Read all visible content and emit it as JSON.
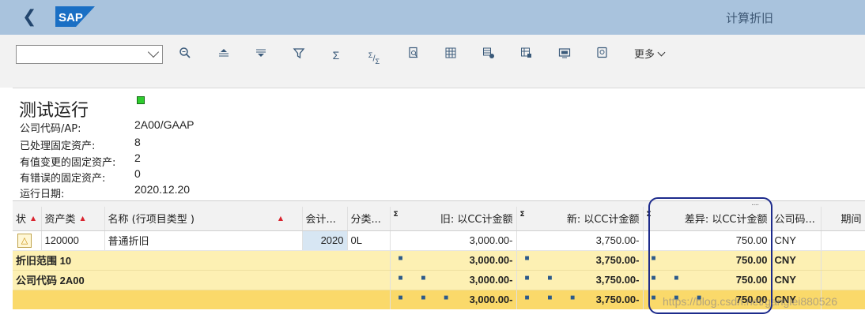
{
  "shell": {
    "app_title": "计算折旧",
    "logo_text": "SAP",
    "back_icon": "chevron-left-icon"
  },
  "toolbar": {
    "variant_value": "",
    "icons": [
      "zoom-in-icon",
      "align-top-icon",
      "align-center-icon",
      "filter-icon",
      "sum-icon",
      "subtotal-icon",
      "print-preview-icon",
      "table-settings-icon",
      "grid-config-icon",
      "layout-icon",
      "export-icon",
      "view-icon"
    ],
    "more_label": "更多"
  },
  "header": {
    "title": "测试运行",
    "status_color": "#2ecc2e",
    "fields": [
      {
        "label": "公司代码/AP:",
        "value": "2A00/GAAP"
      },
      {
        "label": "已处理固定资产:",
        "value": "8"
      },
      {
        "label": "有值变更的固定资产:",
        "value": "2"
      },
      {
        "label": "有错误的固定资产:",
        "value": "0"
      },
      {
        "label": "运行日期:",
        "value": "2020.12.20"
      }
    ]
  },
  "table": {
    "columns": {
      "status": "状",
      "asset_class": "资产类",
      "name": "名称 (行项目类型 )",
      "fiscal_year": "会计...",
      "category": "分类...",
      "old_amount": "旧:  以CC计金额",
      "new_amount": "新:  以CC计金额",
      "diff_amount": "差异:  以CC计金额",
      "currency": "公司码...",
      "period": "期间"
    },
    "sum_sign": "Σ",
    "data_row": {
      "asset_class": "120000",
      "name": "普通折旧",
      "fiscal_year": "2020",
      "category": "0L",
      "old_amount": "3,000.00-",
      "new_amount": "3,750.00-",
      "diff_amount": "750.00",
      "currency": "CNY",
      "period": ""
    },
    "subtotals": [
      {
        "label": "折旧范围 10",
        "level": "■",
        "old_amount": "3,000.00-",
        "new_amount": "3,750.00-",
        "diff_amount": "750.00",
        "currency": "CNY"
      },
      {
        "label": "公司代码 2A00",
        "level": "■ ■",
        "old_amount": "3,000.00-",
        "new_amount": "3,750.00-",
        "diff_amount": "750.00",
        "currency": "CNY"
      }
    ],
    "total": {
      "label": "",
      "level": "■ ■ ■",
      "old_amount": "3,000.00-",
      "new_amount": "3,750.00-",
      "diff_amount": "750.00",
      "currency": "CNY"
    }
  },
  "watermark": "https://blog.csdn.net/ganglei880526",
  "colors": {
    "shell_bg": "#a9c3dd",
    "subtotal_bg": "#fdf0b3",
    "total_bg": "#fad96a",
    "highlight_border": "#1d2b8c"
  }
}
